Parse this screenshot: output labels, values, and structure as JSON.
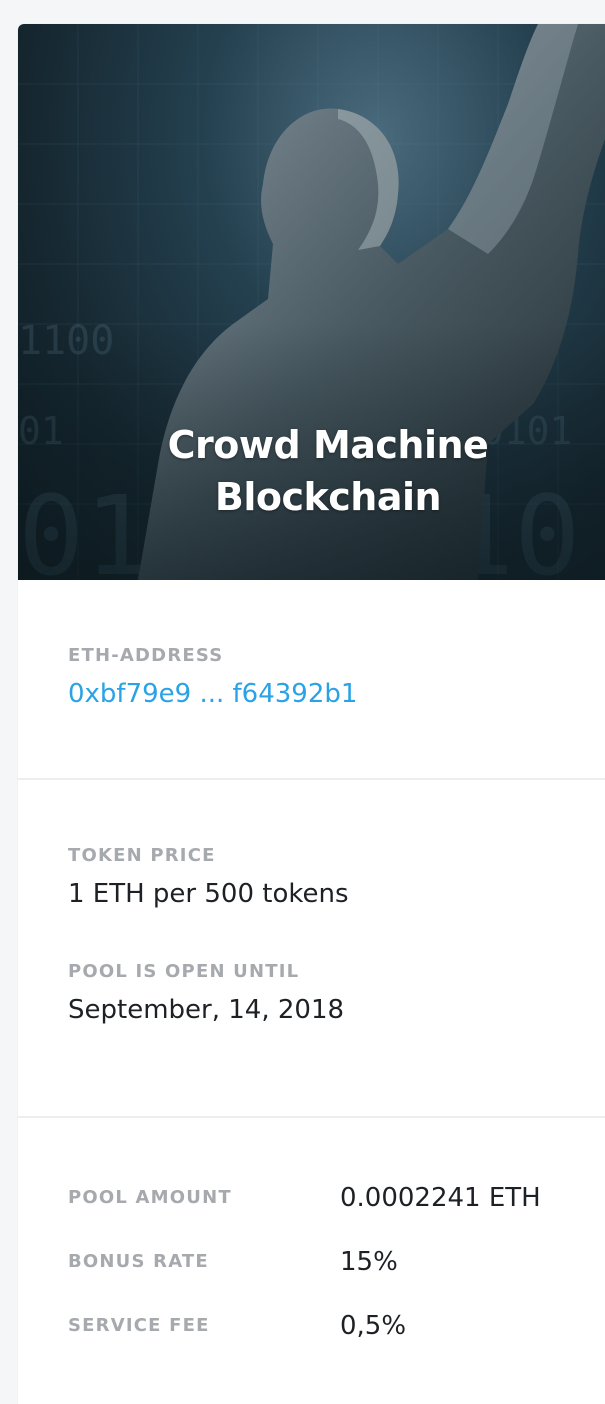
{
  "hero": {
    "title_line1": "Crowd Machine",
    "title_line2": "Blockchain"
  },
  "address": {
    "label": "ETH-ADDRESS",
    "value": "0xbf79e9 ... f64392b1"
  },
  "price": {
    "label": "TOKEN PRICE",
    "value": "1 ETH per 500 tokens"
  },
  "open_until": {
    "label": "POOL IS OPEN UNTIL",
    "value": "September, 14, 2018"
  },
  "stats": [
    {
      "label": "POOL AMOUNT",
      "value": "0.0002241 ETH"
    },
    {
      "label": "BONUS RATE",
      "value": "15%"
    },
    {
      "label": "SERVICE FEE",
      "value": "0,5%"
    }
  ],
  "colors": {
    "link": "#2aa3e6",
    "label": "#a6a9ad",
    "text": "#1d2125"
  }
}
